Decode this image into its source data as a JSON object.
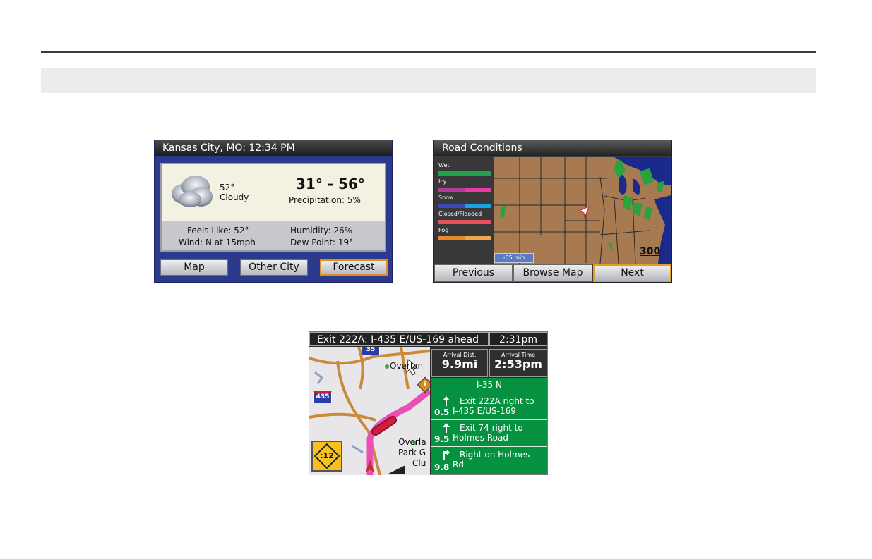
{
  "weather": {
    "title": "Kansas City, MO: 12:34 PM",
    "current_temp": "52°",
    "condition": "Cloudy",
    "range": "31° - 56°",
    "precipitation": "Precipitation: 5%",
    "feels_like": "Feels Like: 52°",
    "wind": "Wind: N at 15mph",
    "humidity": "Humidity: 26%",
    "dew_point": "Dew Point: 19°",
    "buttons": {
      "map": "Map",
      "other_city": "Other City",
      "forecast": "Forecast"
    },
    "colors": {
      "frame": "#2b3a8a",
      "selected_border": "#e08a2a"
    }
  },
  "road_conditions": {
    "title": "Road Conditions",
    "legend": [
      {
        "label": "Wet",
        "colors": [
          "#22a24a",
          "#22a24a"
        ]
      },
      {
        "label": "Icy",
        "colors": [
          "#b23a9a",
          "#ea3aa8"
        ]
      },
      {
        "label": "Snow",
        "colors": [
          "#3a48b8",
          "#1aa2e8"
        ]
      },
      {
        "label": "Closed/Flooded",
        "colors": [
          "#e8505a",
          "#e8505a"
        ]
      },
      {
        "label": "Fog",
        "colors": [
          "#e88a2a",
          "#f0a84a"
        ]
      }
    ],
    "time_offset": "-05 min",
    "scale": "300",
    "buttons": {
      "previous": "Previous",
      "browse_map": "Browse Map",
      "next": "Next"
    }
  },
  "navigation": {
    "next_maneuver": "Exit 222A: I-435 E/US-169 ahead",
    "clock": "2:31pm",
    "arrival_dist_label": "Arrival Dist.",
    "arrival_dist": "9.9mi",
    "arrival_time_label": "Arrival Time",
    "arrival_time": "2:53pm",
    "current_road": "I-35 N",
    "map_labels": {
      "route_35": "35",
      "route_435": "435",
      "place_1": "Overlan",
      "place_2_line1": "Overla",
      "place_2_line2": "Park G",
      "place_2_line3": "Clu",
      "poi": "i",
      "alert": ":12"
    },
    "turns": [
      {
        "dist": "0.5",
        "line1": "Exit 222A right to",
        "line2": "I-435 E/US-169",
        "icon": "straight-arrow-icon"
      },
      {
        "dist": "9.5",
        "line1": "Exit 74 right to",
        "line2": "Holmes Road",
        "icon": "straight-arrow-icon"
      },
      {
        "dist": "9.8",
        "line1": "Right on Holmes",
        "line2": "Rd",
        "icon": "right-turn-icon"
      }
    ],
    "colors": {
      "turn_list": "#05913f",
      "route": "#e94fb4"
    }
  }
}
